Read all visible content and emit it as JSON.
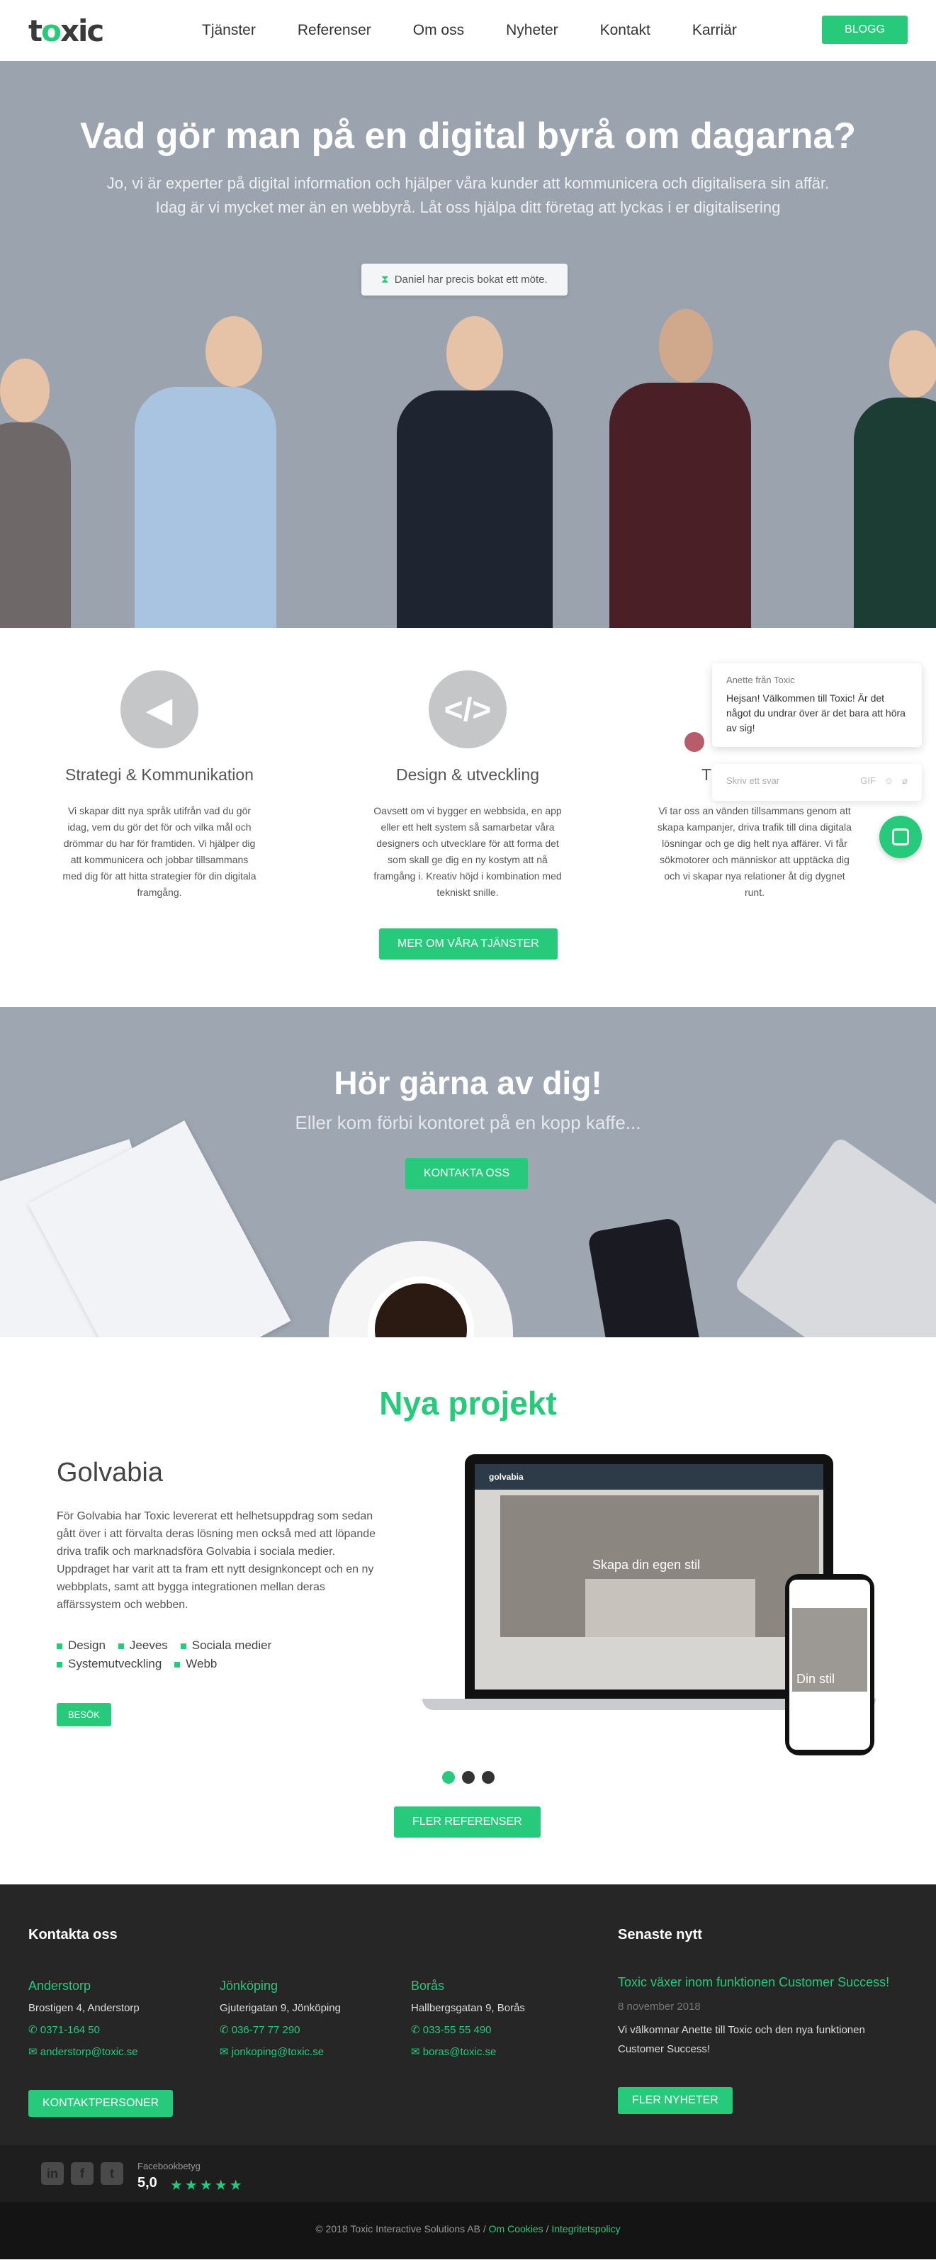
{
  "nav": {
    "logo": "toxic",
    "items": [
      "Tjänster",
      "Referenser",
      "Om oss",
      "Nyheter",
      "Kontakt",
      "Karriär"
    ],
    "blog_button": "BLOGG"
  },
  "hero": {
    "title": "Vad gör man på en digital byrå om dagarna?",
    "subtitle_line1": "Jo, vi är experter på digital information och hjälper våra kunder att kommunicera och digitalisera sin affär.",
    "subtitle_line2": "Idag är vi mycket mer än en webbyrå. Låt oss hjälpa ditt företag att lyckas i er digitalisering",
    "notice": "Daniel har precis bokat ett möte."
  },
  "services": {
    "items": [
      {
        "title": "Strategi & Kommunikation",
        "text": "Vi skapar ditt nya språk utifrån vad du gör idag, vem du gör det för och vilka mål och drömmar du har för framtiden. Vi hjälper dig att kommunicera och jobbar tillsammans med dig för att hitta strategier för din digitala framgång."
      },
      {
        "title": "Design & utveckling",
        "text": "Oavsett om vi bygger en webbsida, en app eller ett helt system så samarbetar våra designers och utvecklare för att forma det som skall ge dig en ny kostym att nå framgång i. Kreativ höjd i kombination med tekniskt snille."
      },
      {
        "title": "T",
        "text": "Vi tar oss an vänden tillsammans genom att skapa kampanjer, driva trafik till dina digitala lösningar och ge dig helt nya affärer. Vi får sökmotorer och människor att upptäcka dig och vi skapar nya relationer åt dig dygnet runt."
      }
    ],
    "button": "MER OM VÅRA TJÄNSTER"
  },
  "chat": {
    "from": "Anette från Toxic",
    "message": "Hejsan! Välkommen till Toxic! Är det något du undrar över är det bara att höra av sig!",
    "placeholder": "Skriv ett svar",
    "gif_label": "GIF"
  },
  "contact_banner": {
    "title": "Hör gärna av dig!",
    "subtitle": "Eller kom förbi kontoret på en kopp kaffe...",
    "button": "KONTAKTA OSS"
  },
  "projects": {
    "heading": "Nya projekt",
    "title": "Golvabia",
    "description": "För Golvabia har Toxic levererat ett helhetsuppdrag som sedan gått över i att förvalta deras lösning men också med att löpande driva trafik och marknadsföra Golvabia i sociala medier. Uppdraget har varit att ta fram ett nytt designkoncept och en ny webbplats, samt att bygga integrationen mellan deras affärssystem och webben.",
    "tags": [
      "Design",
      "Jeeves",
      "Sociala medier",
      "Systemutveckling",
      "Webb"
    ],
    "visit_button": "BESÖK",
    "screen_brand": "golvabia",
    "screen_headline": "Skapa din egen stil",
    "mobile_headline": "Din stil",
    "more_button": "FLER REFERENSER"
  },
  "footer": {
    "contact_heading": "Kontakta oss",
    "offices": [
      {
        "name": "Anderstorp",
        "address": "Brostigen 4, Anderstorp",
        "phone": "0371-164 50",
        "email": "anderstorp@toxic.se"
      },
      {
        "name": "Jönköping",
        "address": "Gjuterigatan 9, Jönköping",
        "phone": "036-77 77 290",
        "email": "jonkoping@toxic.se"
      },
      {
        "name": "Borås",
        "address": "Hallbergsgatan 9, Borås",
        "phone": "033-55 55 490",
        "email": "boras@toxic.se"
      }
    ],
    "contacts_button": "KONTAKTPERSONER",
    "news_heading": "Senaste nytt",
    "news_title": "Toxic växer inom funktionen Customer Success!",
    "news_date": "8 november 2018",
    "news_text": "Vi välkomnar Anette till Toxic och den nya funktionen Customer Success!",
    "news_button": "FLER NYHETER",
    "fb_label": "Facebookbetyg",
    "fb_score": "5,0",
    "stars": "★★★★★",
    "copyright": "© 2018 Toxic Interactive Solutions AB /",
    "cookies": "Om Cookies",
    "sep": "/",
    "privacy": "Integritetspolicy"
  }
}
